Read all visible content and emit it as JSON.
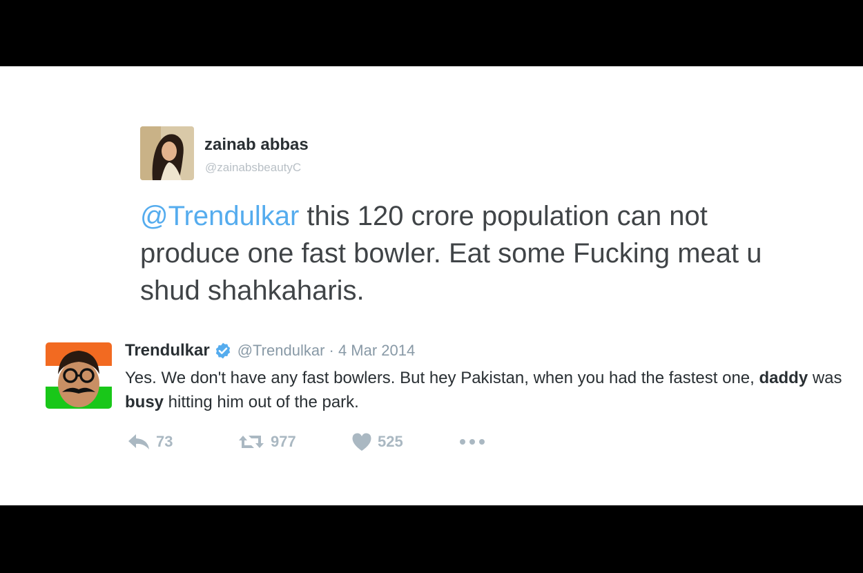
{
  "quoted_tweet": {
    "display_name": "zainab abbas",
    "handle": "@zainabsbeautyC",
    "mention": "@Trendulkar",
    "text": " this 120 crore population can not produce one fast bowler. Eat some Fucking meat u shud shahkaharis."
  },
  "reply_tweet": {
    "display_name": "Trendulkar",
    "verified_icon": "verified-badge-icon",
    "handle": "@Trendulkar",
    "separator": " · ",
    "date": "4 Mar 2014",
    "body": {
      "part1": "Yes. We don't have any fast bowlers. But hey Pakistan, when you had the fastest one, ",
      "bold1": "daddy",
      "part2": " was ",
      "bold2": "busy",
      "part3": " hitting him out of the park."
    },
    "actions": {
      "reply_count": "73",
      "retweet_count": "977",
      "like_count": "525"
    }
  },
  "colors": {
    "mention": "#55acee",
    "verified": "#55acee",
    "action": "#aab8c2",
    "letterbox": "#000000"
  }
}
